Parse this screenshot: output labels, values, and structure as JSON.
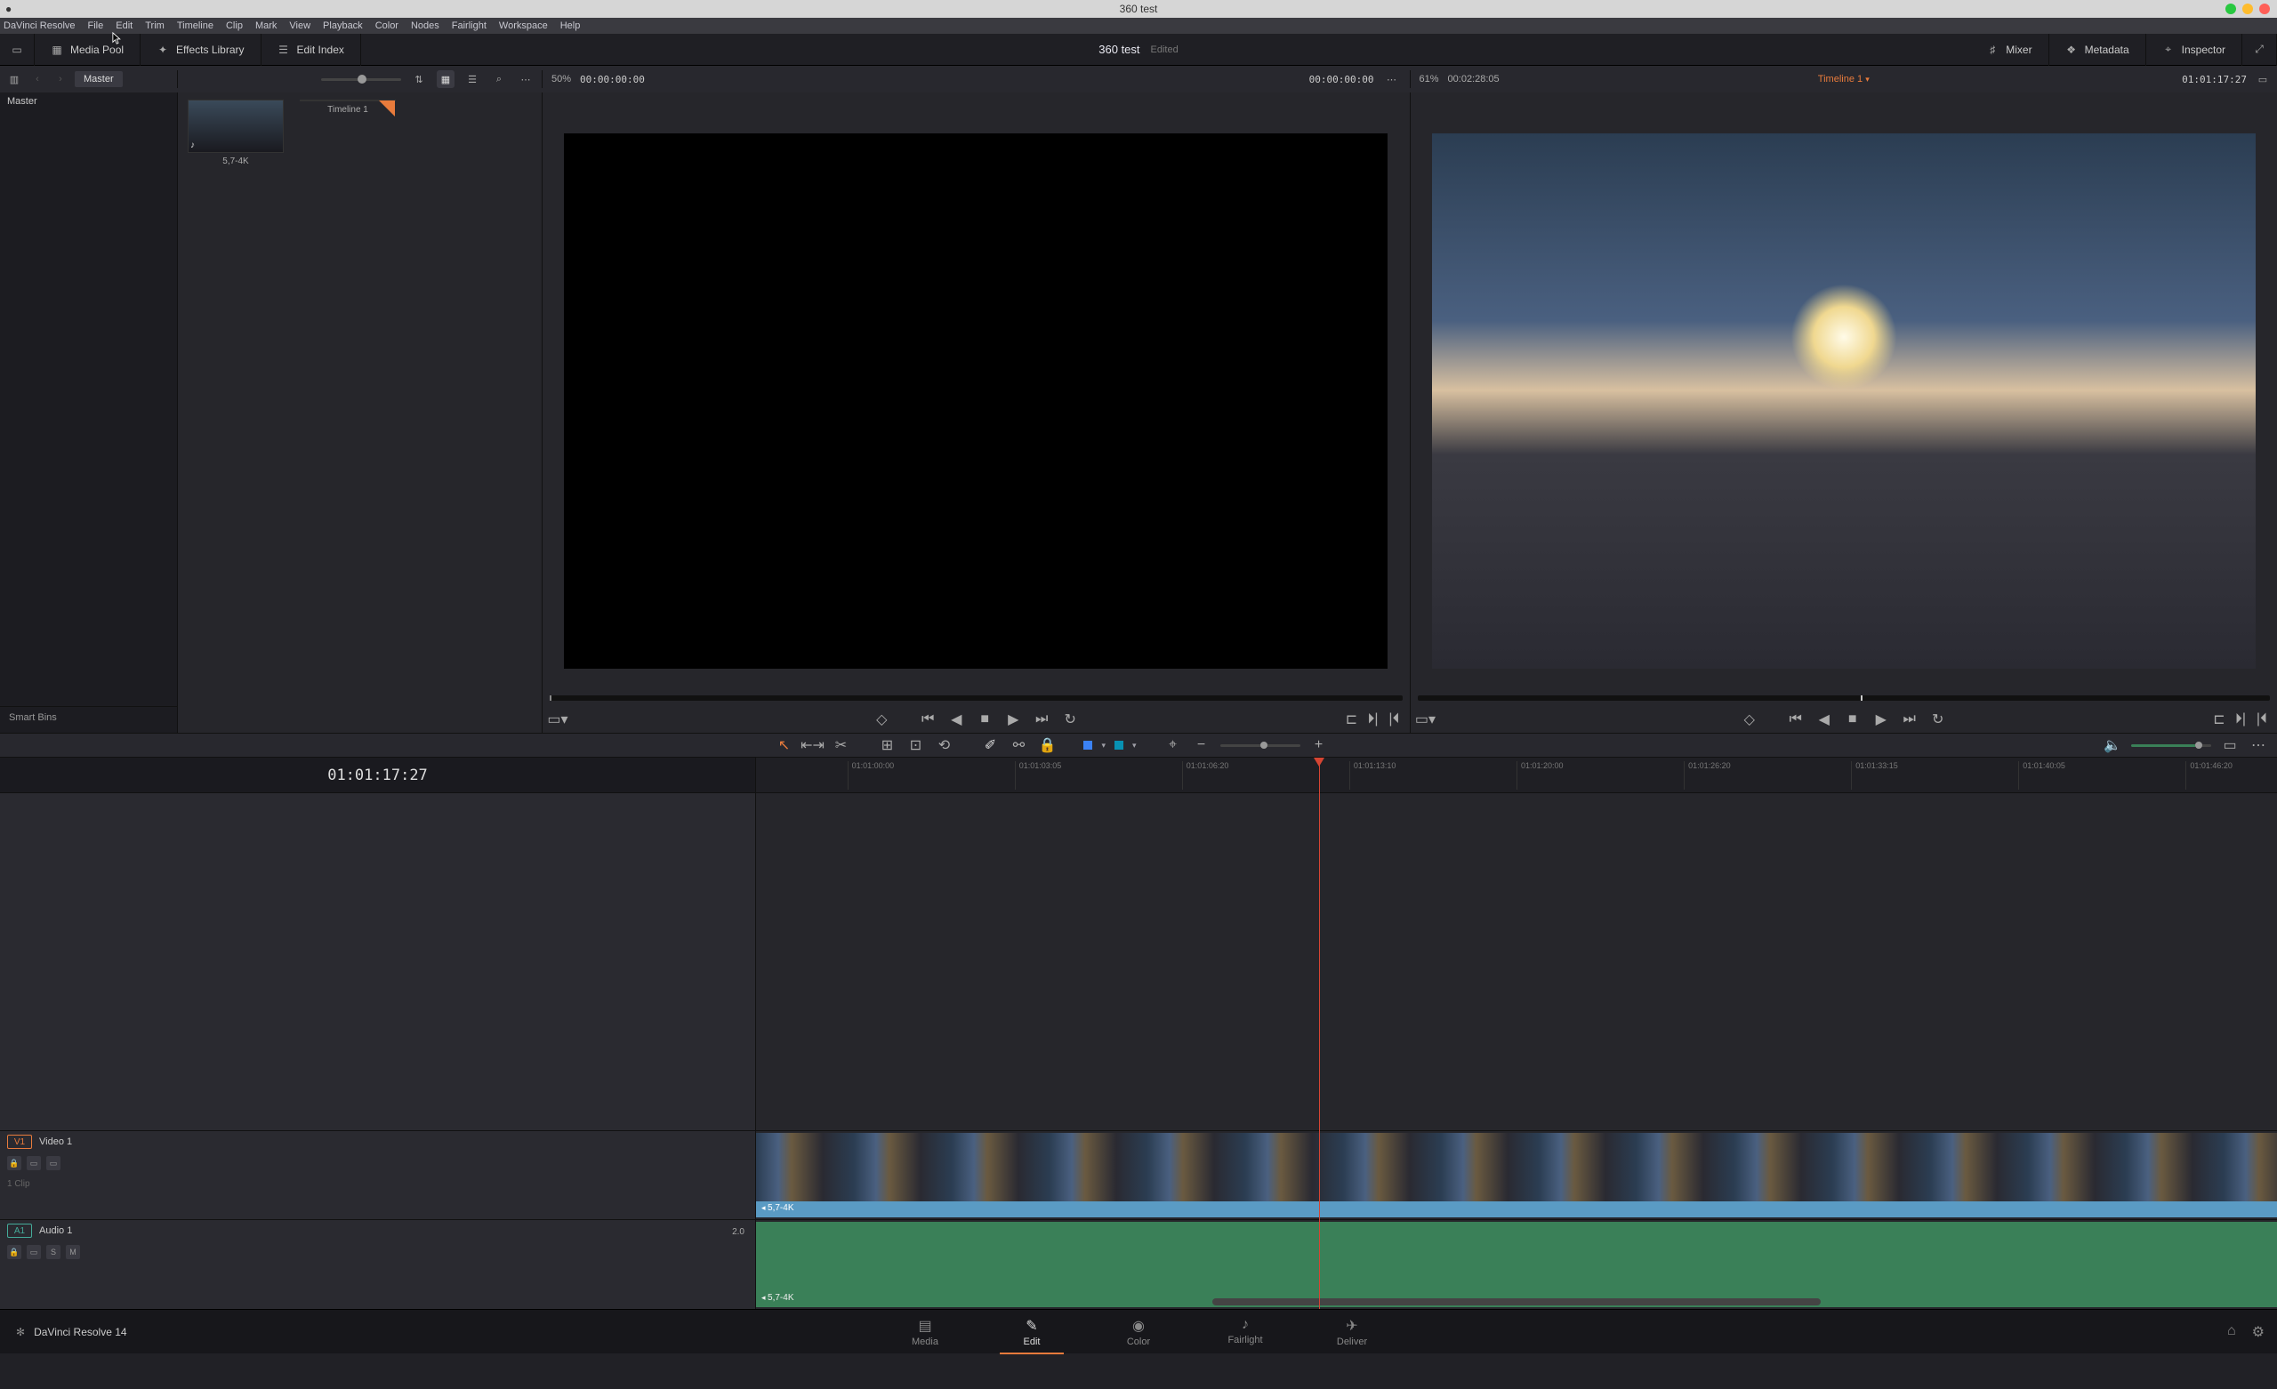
{
  "titlebar": {
    "title": "360 test"
  },
  "menubar": [
    "DaVinci Resolve",
    "File",
    "Edit",
    "Trim",
    "Timeline",
    "Clip",
    "Mark",
    "View",
    "Playback",
    "Color",
    "Nodes",
    "Fairlight",
    "Workspace",
    "Help"
  ],
  "toolbar": {
    "media_pool": "Media Pool",
    "effects_library": "Effects Library",
    "edit_index": "Edit Index",
    "mixer": "Mixer",
    "metadata": "Metadata",
    "inspector": "Inspector"
  },
  "project": {
    "name": "360 test",
    "status": "Edited"
  },
  "mediapool": {
    "breadcrumb": "Master",
    "root_bin": "Master",
    "smart_bins": "Smart Bins",
    "source_zoom": "50%",
    "source_tc": "00:00:00:00",
    "prog_tc_left": "00:00:00:00",
    "prog_zoom": "61%",
    "prog_dur": "00:02:28:05",
    "timeline_name": "Timeline 1",
    "prog_tc_right": "01:01:17:27",
    "clips": [
      {
        "name": "5,7-4K",
        "type": "av"
      },
      {
        "name": "Timeline 1",
        "type": "timeline"
      }
    ]
  },
  "timeline": {
    "current_tc": "01:01:17:27",
    "ruler": [
      "01:01:00:00",
      "01:01:03:05",
      "01:01:06:20",
      "01:01:13:10",
      "01:01:20:00",
      "01:01:26:20",
      "01:01:33:15",
      "01:01:40:05",
      "01:01:46:20"
    ],
    "video_track": {
      "num": "V1",
      "name": "Video 1",
      "clip_name": "5,7-4K",
      "clip_count": "1 Clip"
    },
    "audio_track": {
      "num": "A1",
      "name": "Audio 1",
      "level": "2.0",
      "clip_name": "5,7-4K"
    },
    "playhead_pct": 37
  },
  "pages": [
    "Media",
    "Edit",
    "Color",
    "Fairlight",
    "Deliver"
  ],
  "active_page": "Edit",
  "brand": "DaVinci Resolve 14"
}
